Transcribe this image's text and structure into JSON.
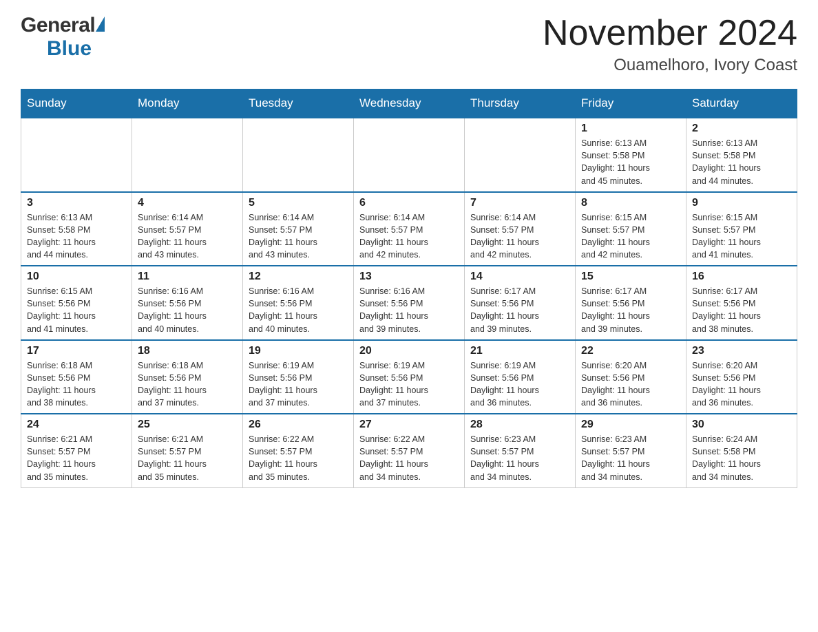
{
  "header": {
    "logo_general": "General",
    "logo_blue": "Blue",
    "month_year": "November 2024",
    "location": "Ouamelhoro, Ivory Coast"
  },
  "days_of_week": [
    "Sunday",
    "Monday",
    "Tuesday",
    "Wednesday",
    "Thursday",
    "Friday",
    "Saturday"
  ],
  "weeks": [
    {
      "days": [
        {
          "date": "",
          "info": ""
        },
        {
          "date": "",
          "info": ""
        },
        {
          "date": "",
          "info": ""
        },
        {
          "date": "",
          "info": ""
        },
        {
          "date": "",
          "info": ""
        },
        {
          "date": "1",
          "info": "Sunrise: 6:13 AM\nSunset: 5:58 PM\nDaylight: 11 hours\nand 45 minutes."
        },
        {
          "date": "2",
          "info": "Sunrise: 6:13 AM\nSunset: 5:58 PM\nDaylight: 11 hours\nand 44 minutes."
        }
      ]
    },
    {
      "days": [
        {
          "date": "3",
          "info": "Sunrise: 6:13 AM\nSunset: 5:58 PM\nDaylight: 11 hours\nand 44 minutes."
        },
        {
          "date": "4",
          "info": "Sunrise: 6:14 AM\nSunset: 5:57 PM\nDaylight: 11 hours\nand 43 minutes."
        },
        {
          "date": "5",
          "info": "Sunrise: 6:14 AM\nSunset: 5:57 PM\nDaylight: 11 hours\nand 43 minutes."
        },
        {
          "date": "6",
          "info": "Sunrise: 6:14 AM\nSunset: 5:57 PM\nDaylight: 11 hours\nand 42 minutes."
        },
        {
          "date": "7",
          "info": "Sunrise: 6:14 AM\nSunset: 5:57 PM\nDaylight: 11 hours\nand 42 minutes."
        },
        {
          "date": "8",
          "info": "Sunrise: 6:15 AM\nSunset: 5:57 PM\nDaylight: 11 hours\nand 42 minutes."
        },
        {
          "date": "9",
          "info": "Sunrise: 6:15 AM\nSunset: 5:57 PM\nDaylight: 11 hours\nand 41 minutes."
        }
      ]
    },
    {
      "days": [
        {
          "date": "10",
          "info": "Sunrise: 6:15 AM\nSunset: 5:56 PM\nDaylight: 11 hours\nand 41 minutes."
        },
        {
          "date": "11",
          "info": "Sunrise: 6:16 AM\nSunset: 5:56 PM\nDaylight: 11 hours\nand 40 minutes."
        },
        {
          "date": "12",
          "info": "Sunrise: 6:16 AM\nSunset: 5:56 PM\nDaylight: 11 hours\nand 40 minutes."
        },
        {
          "date": "13",
          "info": "Sunrise: 6:16 AM\nSunset: 5:56 PM\nDaylight: 11 hours\nand 39 minutes."
        },
        {
          "date": "14",
          "info": "Sunrise: 6:17 AM\nSunset: 5:56 PM\nDaylight: 11 hours\nand 39 minutes."
        },
        {
          "date": "15",
          "info": "Sunrise: 6:17 AM\nSunset: 5:56 PM\nDaylight: 11 hours\nand 39 minutes."
        },
        {
          "date": "16",
          "info": "Sunrise: 6:17 AM\nSunset: 5:56 PM\nDaylight: 11 hours\nand 38 minutes."
        }
      ]
    },
    {
      "days": [
        {
          "date": "17",
          "info": "Sunrise: 6:18 AM\nSunset: 5:56 PM\nDaylight: 11 hours\nand 38 minutes."
        },
        {
          "date": "18",
          "info": "Sunrise: 6:18 AM\nSunset: 5:56 PM\nDaylight: 11 hours\nand 37 minutes."
        },
        {
          "date": "19",
          "info": "Sunrise: 6:19 AM\nSunset: 5:56 PM\nDaylight: 11 hours\nand 37 minutes."
        },
        {
          "date": "20",
          "info": "Sunrise: 6:19 AM\nSunset: 5:56 PM\nDaylight: 11 hours\nand 37 minutes."
        },
        {
          "date": "21",
          "info": "Sunrise: 6:19 AM\nSunset: 5:56 PM\nDaylight: 11 hours\nand 36 minutes."
        },
        {
          "date": "22",
          "info": "Sunrise: 6:20 AM\nSunset: 5:56 PM\nDaylight: 11 hours\nand 36 minutes."
        },
        {
          "date": "23",
          "info": "Sunrise: 6:20 AM\nSunset: 5:56 PM\nDaylight: 11 hours\nand 36 minutes."
        }
      ]
    },
    {
      "days": [
        {
          "date": "24",
          "info": "Sunrise: 6:21 AM\nSunset: 5:57 PM\nDaylight: 11 hours\nand 35 minutes."
        },
        {
          "date": "25",
          "info": "Sunrise: 6:21 AM\nSunset: 5:57 PM\nDaylight: 11 hours\nand 35 minutes."
        },
        {
          "date": "26",
          "info": "Sunrise: 6:22 AM\nSunset: 5:57 PM\nDaylight: 11 hours\nand 35 minutes."
        },
        {
          "date": "27",
          "info": "Sunrise: 6:22 AM\nSunset: 5:57 PM\nDaylight: 11 hours\nand 34 minutes."
        },
        {
          "date": "28",
          "info": "Sunrise: 6:23 AM\nSunset: 5:57 PM\nDaylight: 11 hours\nand 34 minutes."
        },
        {
          "date": "29",
          "info": "Sunrise: 6:23 AM\nSunset: 5:57 PM\nDaylight: 11 hours\nand 34 minutes."
        },
        {
          "date": "30",
          "info": "Sunrise: 6:24 AM\nSunset: 5:58 PM\nDaylight: 11 hours\nand 34 minutes."
        }
      ]
    }
  ]
}
